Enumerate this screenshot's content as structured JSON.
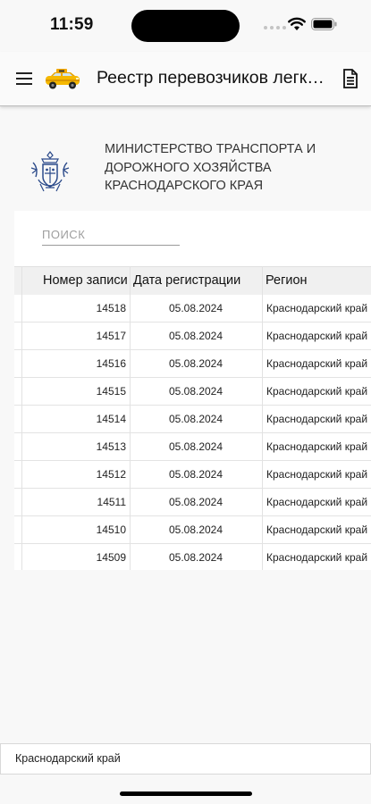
{
  "status_bar": {
    "time": "11:59"
  },
  "app_bar": {
    "title": "Реестр перевозчиков легк…"
  },
  "ministry": {
    "name": "МИНИСТЕРСТВО ТРАНСПОРТА И ДОРОЖНОГО ХОЗЯЙСТВА КРАСНОДАРСКОГО КРАЯ"
  },
  "search": {
    "placeholder": "ПОИСК",
    "value": ""
  },
  "table": {
    "headers": [
      "Номер записи",
      "Дата регистрации",
      "Регион"
    ],
    "rows": [
      {
        "number": "14518",
        "date": "05.08.2024",
        "region": "Краснодарский край"
      },
      {
        "number": "14517",
        "date": "05.08.2024",
        "region": "Краснодарский край"
      },
      {
        "number": "14516",
        "date": "05.08.2024",
        "region": "Краснодарский край"
      },
      {
        "number": "14515",
        "date": "05.08.2024",
        "region": "Краснодарский край"
      },
      {
        "number": "14514",
        "date": "05.08.2024",
        "region": "Краснодарский край"
      },
      {
        "number": "14513",
        "date": "05.08.2024",
        "region": "Краснодарский край"
      },
      {
        "number": "14512",
        "date": "05.08.2024",
        "region": "Краснодарский край"
      },
      {
        "number": "14511",
        "date": "05.08.2024",
        "region": "Краснодарский край"
      },
      {
        "number": "14510",
        "date": "05.08.2024",
        "region": "Краснодарский край"
      },
      {
        "number": "14509",
        "date": "05.08.2024",
        "region": "Краснодарский край"
      }
    ]
  },
  "bottom_field": {
    "value": "Краснодарский край"
  },
  "icons": {
    "menu": "hamburger-menu-icon",
    "app_logo": "taxi-car-icon",
    "document": "document-icon",
    "emblem": "krasnodar-krai-emblem",
    "wifi": "wifi-icon",
    "battery": "battery-icon"
  },
  "colors": {
    "taxi_yellow": "#f5b800",
    "emblem_blue": "#2b4a8a",
    "header_bg": "#f0f0f0"
  }
}
